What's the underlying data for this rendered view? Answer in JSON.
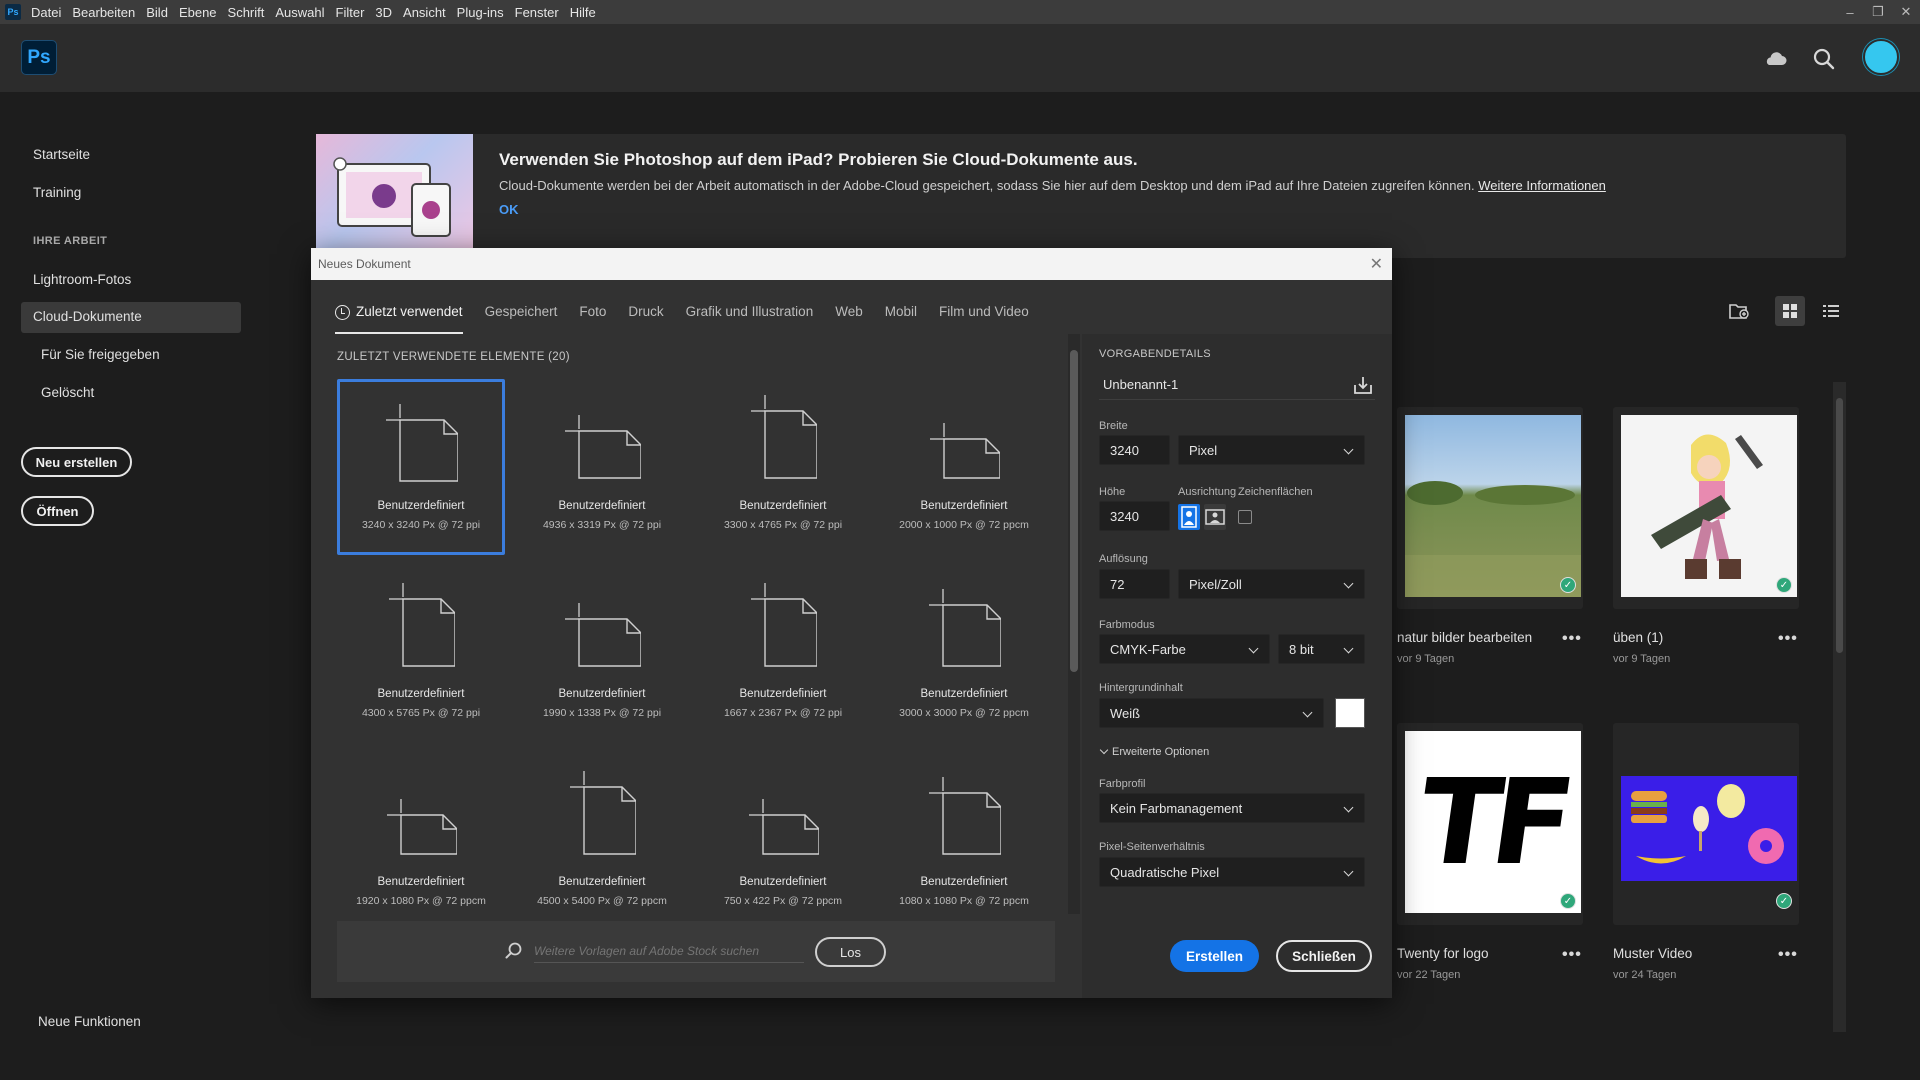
{
  "menubar": {
    "logo": "Ps",
    "items": [
      "Datei",
      "Bearbeiten",
      "Bild",
      "Ebene",
      "Schrift",
      "Auswahl",
      "Filter",
      "3D",
      "Ansicht",
      "Plug-ins",
      "Fenster",
      "Hilfe"
    ]
  },
  "header": {
    "logo": "Ps",
    "icons": [
      "cloud-icon",
      "search-icon",
      "avatar"
    ]
  },
  "sidebar": {
    "home": "Startseite",
    "training": "Training",
    "section": "IHRE ARBEIT",
    "lightroom": "Lightroom-Fotos",
    "cloud_docs": "Cloud-Dokumente",
    "shared": "Für Sie freigegeben",
    "deleted": "Gelöscht",
    "new_button": "Neu erstellen",
    "open_button": "Öffnen",
    "news": "Neue Funktionen"
  },
  "banner": {
    "title": "Verwenden Sie Photoshop auf dem iPad? Probieren Sie Cloud-Dokumente aus.",
    "text": "Cloud-Dokumente werden bei der Arbeit automatisch in der Adobe-Cloud gespeichert, sodass Sie hier auf dem Desktop und dem iPad auf Ihre Dateien zugreifen können.",
    "link": "Weitere Informationen",
    "ok": "OK"
  },
  "docs": [
    {
      "name": "natur bilder bearbeiten",
      "time": "vor 9 Tagen",
      "more": "•••"
    },
    {
      "name": "üben (1)",
      "time": "vor 9 Tagen",
      "more": "•••"
    },
    {
      "name": "Twenty for logo",
      "time": "vor 22 Tagen",
      "more": "•••"
    },
    {
      "name": "Muster Video",
      "time": "vor 24 Tagen",
      "more": "•••"
    }
  ],
  "tf_logo": "TF",
  "dialog": {
    "title": "Neues Dokument",
    "tabs": [
      "Zuletzt verwendet",
      "Gespeichert",
      "Foto",
      "Druck",
      "Grafik und Illustration",
      "Web",
      "Mobil",
      "Film und Video"
    ],
    "recent_heading": "ZULETZT VERWENDETE ELEMENTE  (20)",
    "presets": [
      {
        "name": "Benutzerdefiniert",
        "size": "3240 x 3240 Px @ 72 ppi",
        "orient": "square"
      },
      {
        "name": "Benutzerdefiniert",
        "size": "4936 x 3319 Px @ 72 ppi",
        "orient": "landscape"
      },
      {
        "name": "Benutzerdefiniert",
        "size": "3300 x 4765 Px @ 72 ppi",
        "orient": "portrait"
      },
      {
        "name": "Benutzerdefiniert",
        "size": "2000 x 1000 Px @ 72 ppcm",
        "orient": "wide"
      },
      {
        "name": "Benutzerdefiniert",
        "size": "4300 x 5765 Px @ 72 ppi",
        "orient": "portrait"
      },
      {
        "name": "Benutzerdefiniert",
        "size": "1990 x 1338 Px @ 72 ppi",
        "orient": "landscape"
      },
      {
        "name": "Benutzerdefiniert",
        "size": "1667 x 2367 Px @ 72 ppi",
        "orient": "portrait"
      },
      {
        "name": "Benutzerdefiniert",
        "size": "3000 x 3000 Px @ 72 ppcm",
        "orient": "square"
      },
      {
        "name": "Benutzerdefiniert",
        "size": "1920 x 1080 Px @ 72 ppcm",
        "orient": "wide"
      },
      {
        "name": "Benutzerdefiniert",
        "size": "4500 x 5400 Px @ 72 ppcm",
        "orient": "portrait"
      },
      {
        "name": "Benutzerdefiniert",
        "size": "750 x 422 Px @ 72 ppcm",
        "orient": "wide"
      },
      {
        "name": "Benutzerdefiniert",
        "size": "1080 x 1080 Px @ 72 ppcm",
        "orient": "square"
      }
    ],
    "stock_placeholder": "Weitere Vorlagen auf Adobe Stock suchen",
    "stock_button": "Los",
    "panel": {
      "heading": "VORGABENDETAILS",
      "doc_name": "Unbenannt-1",
      "width_label": "Breite",
      "width": "3240",
      "width_unit": "Pixel",
      "height_label": "Höhe",
      "height": "3240",
      "orientation_label": "Ausrichtung",
      "artboards_label": "Zeichenflächen",
      "resolution_label": "Auflösung",
      "resolution": "72",
      "resolution_unit": "Pixel/Zoll",
      "color_mode_label": "Farbmodus",
      "color_mode": "CMYK-Farbe",
      "bit_depth": "8 bit",
      "background_label": "Hintergrundinhalt",
      "background": "Weiß",
      "advanced": "Erweiterte Optionen",
      "profile_label": "Farbprofil",
      "profile": "Kein Farbmanagement",
      "pixel_ratio_label": "Pixel-Seitenverhältnis",
      "pixel_ratio": "Quadratische Pixel",
      "create_button": "Erstellen",
      "close_button": "Schließen"
    }
  },
  "colors": {
    "accent": "#1473e6",
    "selection": "#3b7ddd",
    "check": "#2fa77a"
  }
}
